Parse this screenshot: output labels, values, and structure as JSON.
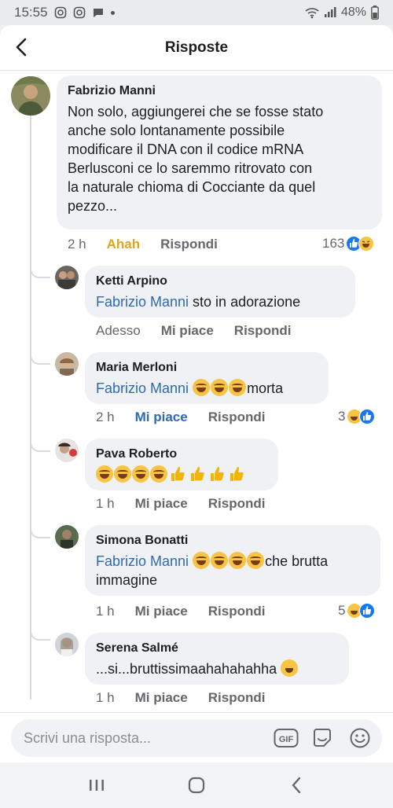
{
  "status_bar": {
    "time": "15:55",
    "battery": "48%"
  },
  "header": {
    "title": "Risposte",
    "back_icon": "back-arrow-icon"
  },
  "comments": [
    {
      "author": "Fabrizio Manni",
      "text_lines": [
        "Non solo, aggiungerei che se fosse stato",
        "anche solo lontanamente possibile",
        "modificare il DNA con il codice mRNA",
        "Berlusconi ce lo saremmo ritrovato con",
        "la naturale chioma di Cocciante da quel",
        "pezzo..."
      ],
      "time": "2 h",
      "reaction_label": "Ahah",
      "reply_label": "Rispondi",
      "reaction_count": "163"
    },
    {
      "author": "Ketti Arpino",
      "mention": "Fabrizio Manni",
      "text": " sto in adorazione",
      "time": "Adesso",
      "like_label": "Mi piace",
      "reply_label": "Rispondi"
    },
    {
      "author": "Maria Merloni",
      "mention": "Fabrizio Manni",
      "text": "morta",
      "time": "2 h",
      "like_label": "Mi piace",
      "reply_label": "Rispondi",
      "reaction_count": "3"
    },
    {
      "author": "Pava Roberto",
      "time": "1 h",
      "like_label": "Mi piace",
      "reply_label": "Rispondi"
    },
    {
      "author": "Simona Bonatti",
      "mention": "Fabrizio Manni",
      "text_line1": "che brutta",
      "text_line2": "immagine",
      "time": "1 h",
      "like_label": "Mi piace",
      "reply_label": "Rispondi",
      "reaction_count": "5"
    },
    {
      "author": "Serena Salmé",
      "text": "...si...bruttissimaahahahahha",
      "time": "1 h",
      "like_label": "Mi piace",
      "reply_label": "Rispondi"
    }
  ],
  "input": {
    "placeholder": "Scrivi una risposta...",
    "gif_label": "GIF"
  },
  "colors": {
    "link": "#2d6ab4",
    "haha": "#e0a51e",
    "bubble": "#eff1f4"
  }
}
